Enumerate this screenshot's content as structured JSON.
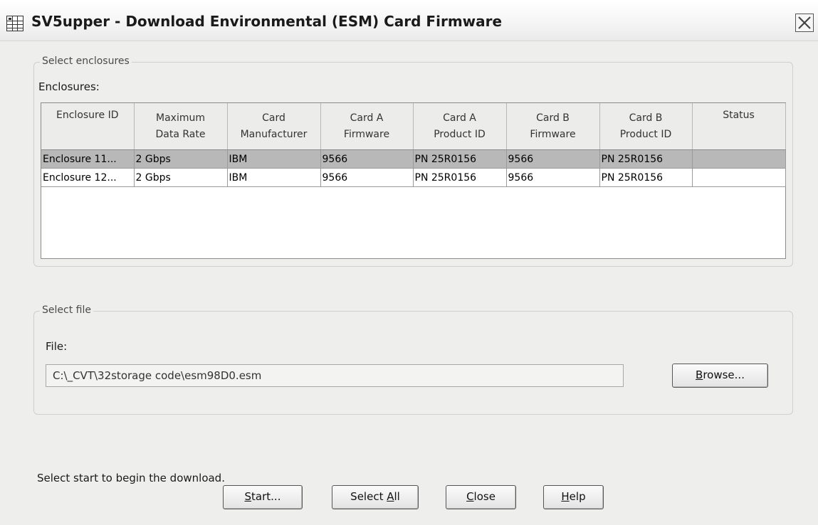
{
  "window": {
    "title": "SV5upper - Download Environmental (ESM) Card Firmware"
  },
  "enclosures_group": {
    "legend": "Select enclosures",
    "label": "Enclosures:",
    "columns": [
      [
        "Enclosure ID"
      ],
      [
        "Maximum",
        "Data Rate"
      ],
      [
        "Card",
        "Manufacturer"
      ],
      [
        "Card A",
        "Firmware"
      ],
      [
        "Card A",
        "Product ID"
      ],
      [
        "Card B",
        "Firmware"
      ],
      [
        "Card B",
        "Product ID"
      ],
      [
        "Status"
      ]
    ],
    "rows": [
      {
        "selected": true,
        "cells": [
          "Enclosure 11...",
          "2 Gbps",
          "IBM",
          "9566",
          "PN 25R0156",
          "9566",
          "PN 25R0156",
          ""
        ]
      },
      {
        "selected": false,
        "cells": [
          "Enclosure 12...",
          "2 Gbps",
          "IBM",
          "9566",
          "PN 25R0156",
          "9566",
          "PN 25R0156",
          ""
        ]
      }
    ]
  },
  "file_group": {
    "legend": "Select file",
    "label": "File:",
    "value": "C:\\_CVT\\32storage code\\esm98D0.esm",
    "browse": {
      "mnemonic": "B",
      "rest": "rowse..."
    }
  },
  "instruction": "Select start to begin the download.",
  "buttons": {
    "start": {
      "before": "",
      "mnemonic": "S",
      "after": "tart..."
    },
    "select_all": {
      "before": "Select ",
      "mnemonic": "A",
      "after": "ll"
    },
    "close": {
      "before": "",
      "mnemonic": "C",
      "after": "lose"
    },
    "help": {
      "before": "",
      "mnemonic": "H",
      "after": "elp"
    }
  },
  "colors": {
    "selected_row": "#b8b8b8",
    "window_bg": "#eeeeec"
  }
}
